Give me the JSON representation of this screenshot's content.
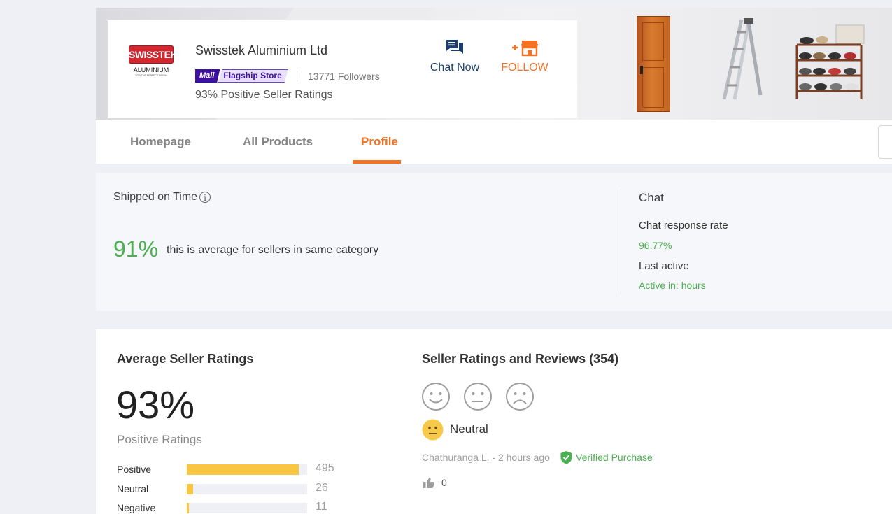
{
  "shop": {
    "logo_text": "SWISSTEK",
    "logo_sub": "ALUMINIUM",
    "logo_tagline": "FOR THE PERFECT FINISH",
    "name": "Swisstek Aluminium Ltd",
    "badge_mall": "Mall",
    "badge_flagship": "Flagship Store",
    "followers": "13771 Followers",
    "positive_ratings_text": "93% Positive Seller Ratings",
    "chat_label": "Chat Now",
    "follow_label": "FOLLOW"
  },
  "tabs": [
    {
      "label": "Homepage",
      "active": false
    },
    {
      "label": "All Products",
      "active": false
    },
    {
      "label": "Profile",
      "active": true
    }
  ],
  "shipping": {
    "title": "Shipped on Time",
    "info_icon": "i",
    "percent": "91%",
    "note": "this is average for sellers in same category"
  },
  "chat": {
    "title": "Chat",
    "response_rate_label": "Chat response rate",
    "response_rate_value": "96.77%",
    "last_active_label": "Last active",
    "last_active_value": "Active in: hours"
  },
  "average_ratings": {
    "title": "Average Seller Ratings",
    "percent": "93%",
    "caption": "Positive Ratings",
    "rows": [
      {
        "label": "Positive",
        "count": "495",
        "fraction": 0.93
      },
      {
        "label": "Neutral",
        "count": "26",
        "fraction": 0.05
      },
      {
        "label": "Negative",
        "count": "11",
        "fraction": 0.02
      }
    ]
  },
  "reviews": {
    "title": "Seller Ratings and Reviews (354)",
    "filter_icons": [
      "smile-face-icon",
      "neutral-face-icon",
      "sad-face-icon"
    ],
    "first_review": {
      "rating_label": "Neutral",
      "reviewer": "Chathuranga L. - 2 hours ago",
      "verified_label": "Verified Purchase",
      "likes": "0"
    }
  },
  "colors": {
    "accent": "#f57224",
    "positive": "#4caf50",
    "bar_fill": "#f9c642",
    "mall_purple": "#3d0f9d"
  }
}
